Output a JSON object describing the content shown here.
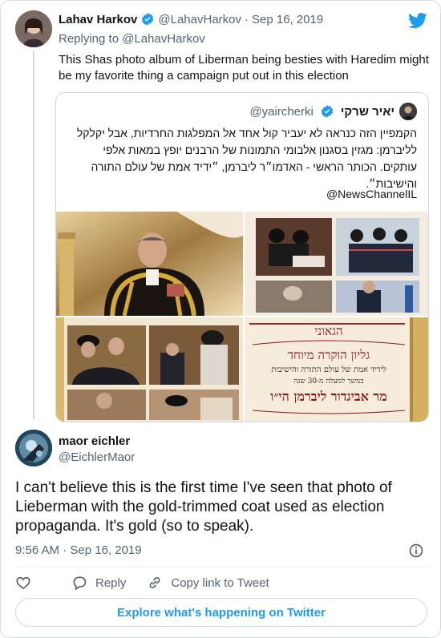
{
  "parent": {
    "name": "Lahav Harkov",
    "handle": "@LahavHarkov",
    "separator": "·",
    "date": "Sep 16, 2019",
    "replying_prefix": "Replying to",
    "replying_to": "@LahavHarkov",
    "text": "This Shas photo album of Liberman being besties with Haredim might be my favorite thing a campaign put out in this election"
  },
  "quote": {
    "name": "יאיר שרקי",
    "handle": "@yaircherki",
    "text": "הקמפיין הזה כנראה לא יעביר קול אחד אל המפלגות החרדיות, אבל יקלקל לליברמן: מגזין בסגנון אלבומי התמונות של הרבנים יופץ במאות אלפי עותקים. הכותר הראשי - האדמו״ר ליברמן, ״ידיד אמת של עולם התורה והישיבות״.",
    "mention": "@NewsChannelIL",
    "media": {
      "banner_line1": "גליון הוקרה מיוחד",
      "banner_line2": "לידיד אמת של עולם התורה והישיבות",
      "banner_line3": "במשך למעלה מ-30 שנה",
      "banner_name": "מר אביגדור ליברמן הי״ו",
      "banner_title": "הגאוני"
    }
  },
  "reply": {
    "name": "maor eichler",
    "handle": "@EichlerMaor",
    "text": "I can't believe this is the first time I've seen that photo of Lieberman with the gold-trimmed coat used as election propaganda. It's gold (so to speak).",
    "time": "9:56 AM",
    "separator": "·",
    "date": "Sep 16, 2019"
  },
  "actions": {
    "reply_label": "Reply",
    "copy_label": "Copy link to Tweet"
  },
  "explore_label": "Explore what's happening on Twitter",
  "colors": {
    "accent": "#1d9bf0",
    "text": "#0f1419",
    "muted": "#536471",
    "border": "#cfd9de"
  },
  "icons": [
    "twitter-logo-icon",
    "verified-badge-icon",
    "info-icon",
    "heart-icon",
    "reply-icon",
    "link-icon"
  ]
}
